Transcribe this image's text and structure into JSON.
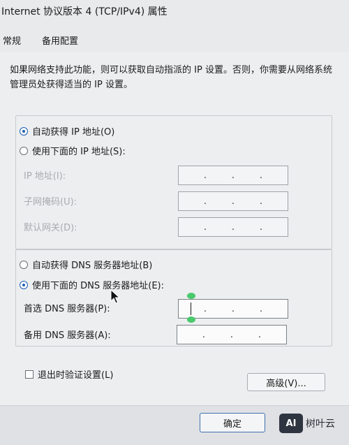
{
  "window": {
    "title": "Internet 协议版本 4 (TCP/IPv4) 属性"
  },
  "tabs": [
    {
      "label": "常规"
    },
    {
      "label": "备用配置"
    }
  ],
  "intro_text": "如果网络支持此功能，则可以获取自动指派的 IP 设置。否则，你需要从网络系统管理员处获得适当的 IP 设置。",
  "ip_section": {
    "auto_label": "自动获得 IP 地址(O)",
    "manual_label": "使用下面的 IP 地址(S):",
    "selected": "auto",
    "fields": [
      {
        "label": "IP 地址(I):",
        "value": ". . ."
      },
      {
        "label": "子网掩码(U):",
        "value": ". . ."
      },
      {
        "label": "默认网关(D):",
        "value": ". . ."
      }
    ]
  },
  "dns_section": {
    "auto_label": "自动获得 DNS 服务器地址(B)",
    "manual_label": "使用下面的 DNS 服务器地址(E):",
    "selected": "manual",
    "fields": [
      {
        "label": "首选 DNS 服务器(P):",
        "value": ". . ."
      },
      {
        "label": "备用 DNS 服务器(A):",
        "value": ". . ."
      }
    ]
  },
  "validate_on_exit": {
    "label": "退出时验证设置(L)",
    "checked": false
  },
  "buttons": {
    "advanced": "高级(V)...",
    "ok": "确定"
  },
  "watermark": {
    "logo": "AI",
    "text": "树叶云"
  },
  "colors": {
    "accent": "#1f5fb2",
    "handle": "#49c96c"
  }
}
